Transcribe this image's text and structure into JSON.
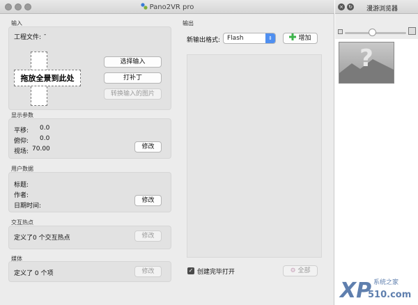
{
  "window": {
    "title": "Pano2VR pro"
  },
  "input": {
    "section": "输入",
    "project_file_label": "工程文件:",
    "project_file_value": "-",
    "drop_label": "拖放全景到此处",
    "select_input": "选择输入",
    "patch": "打补丁",
    "convert": "转换输入的图片"
  },
  "display": {
    "section": "显示参数",
    "pan_label": "平移:",
    "pan_value": "0.0",
    "tilt_label": "俯仰:",
    "tilt_value": "0.0",
    "fov_label": "视场:",
    "fov_value": "70.00",
    "modify": "修改"
  },
  "userdata": {
    "section": "用户数据",
    "title_label": "标题:",
    "author_label": "作者:",
    "datetime_label": "日期时间:",
    "modify": "修改"
  },
  "hotspots": {
    "section": "交互热点",
    "text": "定义了0 个交互热点",
    "modify": "修改"
  },
  "media": {
    "section": "媒体",
    "text": "定义了 0 个项",
    "modify": "修改"
  },
  "output": {
    "section": "输出",
    "new_format_label": "新输出格式:",
    "format_value": "Flash",
    "add": "增加",
    "open_after_create": "创建完毕打开",
    "all": "全部"
  },
  "browser": {
    "title": "漫游浏览器",
    "thumb_size_level": 0.45
  },
  "watermark": {
    "big": "XP",
    "site": "510.com",
    "small": "系统之家"
  },
  "colors": {
    "accent": "#4f8ff0",
    "add_icon": "#3cb34a"
  }
}
